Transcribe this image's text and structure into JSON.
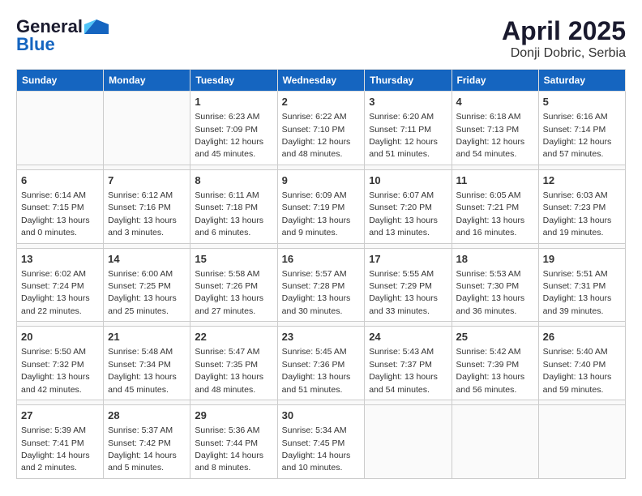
{
  "logo": {
    "general": "General",
    "blue": "Blue"
  },
  "title": "April 2025",
  "location": "Donji Dobric, Serbia",
  "days_header": [
    "Sunday",
    "Monday",
    "Tuesday",
    "Wednesday",
    "Thursday",
    "Friday",
    "Saturday"
  ],
  "weeks": [
    [
      {
        "day": "",
        "sunrise": "",
        "sunset": "",
        "daylight": ""
      },
      {
        "day": "",
        "sunrise": "",
        "sunset": "",
        "daylight": ""
      },
      {
        "day": "1",
        "sunrise": "Sunrise: 6:23 AM",
        "sunset": "Sunset: 7:09 PM",
        "daylight": "Daylight: 12 hours and 45 minutes."
      },
      {
        "day": "2",
        "sunrise": "Sunrise: 6:22 AM",
        "sunset": "Sunset: 7:10 PM",
        "daylight": "Daylight: 12 hours and 48 minutes."
      },
      {
        "day": "3",
        "sunrise": "Sunrise: 6:20 AM",
        "sunset": "Sunset: 7:11 PM",
        "daylight": "Daylight: 12 hours and 51 minutes."
      },
      {
        "day": "4",
        "sunrise": "Sunrise: 6:18 AM",
        "sunset": "Sunset: 7:13 PM",
        "daylight": "Daylight: 12 hours and 54 minutes."
      },
      {
        "day": "5",
        "sunrise": "Sunrise: 6:16 AM",
        "sunset": "Sunset: 7:14 PM",
        "daylight": "Daylight: 12 hours and 57 minutes."
      }
    ],
    [
      {
        "day": "6",
        "sunrise": "Sunrise: 6:14 AM",
        "sunset": "Sunset: 7:15 PM",
        "daylight": "Daylight: 13 hours and 0 minutes."
      },
      {
        "day": "7",
        "sunrise": "Sunrise: 6:12 AM",
        "sunset": "Sunset: 7:16 PM",
        "daylight": "Daylight: 13 hours and 3 minutes."
      },
      {
        "day": "8",
        "sunrise": "Sunrise: 6:11 AM",
        "sunset": "Sunset: 7:18 PM",
        "daylight": "Daylight: 13 hours and 6 minutes."
      },
      {
        "day": "9",
        "sunrise": "Sunrise: 6:09 AM",
        "sunset": "Sunset: 7:19 PM",
        "daylight": "Daylight: 13 hours and 9 minutes."
      },
      {
        "day": "10",
        "sunrise": "Sunrise: 6:07 AM",
        "sunset": "Sunset: 7:20 PM",
        "daylight": "Daylight: 13 hours and 13 minutes."
      },
      {
        "day": "11",
        "sunrise": "Sunrise: 6:05 AM",
        "sunset": "Sunset: 7:21 PM",
        "daylight": "Daylight: 13 hours and 16 minutes."
      },
      {
        "day": "12",
        "sunrise": "Sunrise: 6:03 AM",
        "sunset": "Sunset: 7:23 PM",
        "daylight": "Daylight: 13 hours and 19 minutes."
      }
    ],
    [
      {
        "day": "13",
        "sunrise": "Sunrise: 6:02 AM",
        "sunset": "Sunset: 7:24 PM",
        "daylight": "Daylight: 13 hours and 22 minutes."
      },
      {
        "day": "14",
        "sunrise": "Sunrise: 6:00 AM",
        "sunset": "Sunset: 7:25 PM",
        "daylight": "Daylight: 13 hours and 25 minutes."
      },
      {
        "day": "15",
        "sunrise": "Sunrise: 5:58 AM",
        "sunset": "Sunset: 7:26 PM",
        "daylight": "Daylight: 13 hours and 27 minutes."
      },
      {
        "day": "16",
        "sunrise": "Sunrise: 5:57 AM",
        "sunset": "Sunset: 7:28 PM",
        "daylight": "Daylight: 13 hours and 30 minutes."
      },
      {
        "day": "17",
        "sunrise": "Sunrise: 5:55 AM",
        "sunset": "Sunset: 7:29 PM",
        "daylight": "Daylight: 13 hours and 33 minutes."
      },
      {
        "day": "18",
        "sunrise": "Sunrise: 5:53 AM",
        "sunset": "Sunset: 7:30 PM",
        "daylight": "Daylight: 13 hours and 36 minutes."
      },
      {
        "day": "19",
        "sunrise": "Sunrise: 5:51 AM",
        "sunset": "Sunset: 7:31 PM",
        "daylight": "Daylight: 13 hours and 39 minutes."
      }
    ],
    [
      {
        "day": "20",
        "sunrise": "Sunrise: 5:50 AM",
        "sunset": "Sunset: 7:32 PM",
        "daylight": "Daylight: 13 hours and 42 minutes."
      },
      {
        "day": "21",
        "sunrise": "Sunrise: 5:48 AM",
        "sunset": "Sunset: 7:34 PM",
        "daylight": "Daylight: 13 hours and 45 minutes."
      },
      {
        "day": "22",
        "sunrise": "Sunrise: 5:47 AM",
        "sunset": "Sunset: 7:35 PM",
        "daylight": "Daylight: 13 hours and 48 minutes."
      },
      {
        "day": "23",
        "sunrise": "Sunrise: 5:45 AM",
        "sunset": "Sunset: 7:36 PM",
        "daylight": "Daylight: 13 hours and 51 minutes."
      },
      {
        "day": "24",
        "sunrise": "Sunrise: 5:43 AM",
        "sunset": "Sunset: 7:37 PM",
        "daylight": "Daylight: 13 hours and 54 minutes."
      },
      {
        "day": "25",
        "sunrise": "Sunrise: 5:42 AM",
        "sunset": "Sunset: 7:39 PM",
        "daylight": "Daylight: 13 hours and 56 minutes."
      },
      {
        "day": "26",
        "sunrise": "Sunrise: 5:40 AM",
        "sunset": "Sunset: 7:40 PM",
        "daylight": "Daylight: 13 hours and 59 minutes."
      }
    ],
    [
      {
        "day": "27",
        "sunrise": "Sunrise: 5:39 AM",
        "sunset": "Sunset: 7:41 PM",
        "daylight": "Daylight: 14 hours and 2 minutes."
      },
      {
        "day": "28",
        "sunrise": "Sunrise: 5:37 AM",
        "sunset": "Sunset: 7:42 PM",
        "daylight": "Daylight: 14 hours and 5 minutes."
      },
      {
        "day": "29",
        "sunrise": "Sunrise: 5:36 AM",
        "sunset": "Sunset: 7:44 PM",
        "daylight": "Daylight: 14 hours and 8 minutes."
      },
      {
        "day": "30",
        "sunrise": "Sunrise: 5:34 AM",
        "sunset": "Sunset: 7:45 PM",
        "daylight": "Daylight: 14 hours and 10 minutes."
      },
      {
        "day": "",
        "sunrise": "",
        "sunset": "",
        "daylight": ""
      },
      {
        "day": "",
        "sunrise": "",
        "sunset": "",
        "daylight": ""
      },
      {
        "day": "",
        "sunrise": "",
        "sunset": "",
        "daylight": ""
      }
    ]
  ]
}
